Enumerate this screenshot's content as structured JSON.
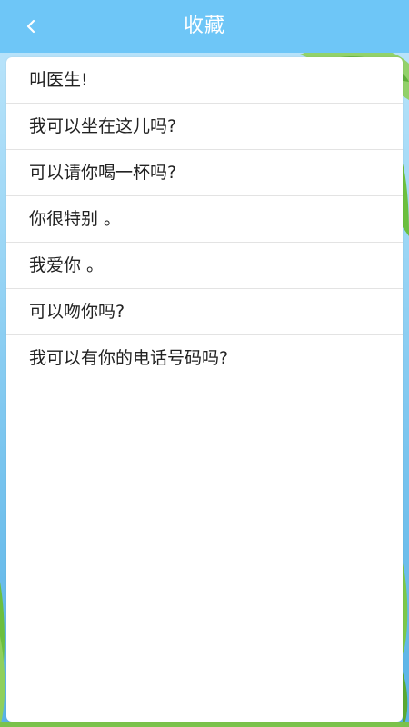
{
  "header": {
    "title": "收藏",
    "back_icon": "chevron-left-icon"
  },
  "favorites": [
    {
      "text": "叫医生!"
    },
    {
      "text": "我可以坐在这儿吗?"
    },
    {
      "text": "可以请你喝一杯吗?"
    },
    {
      "text": "你很特别 。"
    },
    {
      "text": "我爱你 。"
    },
    {
      "text": "可以吻你吗?"
    },
    {
      "text": "我可以有你的电话号码吗?"
    }
  ],
  "colors": {
    "header_bg": "#6ec6f7",
    "title_text": "#ffffff",
    "item_text": "#222222",
    "divider": "#e3e3e3"
  }
}
